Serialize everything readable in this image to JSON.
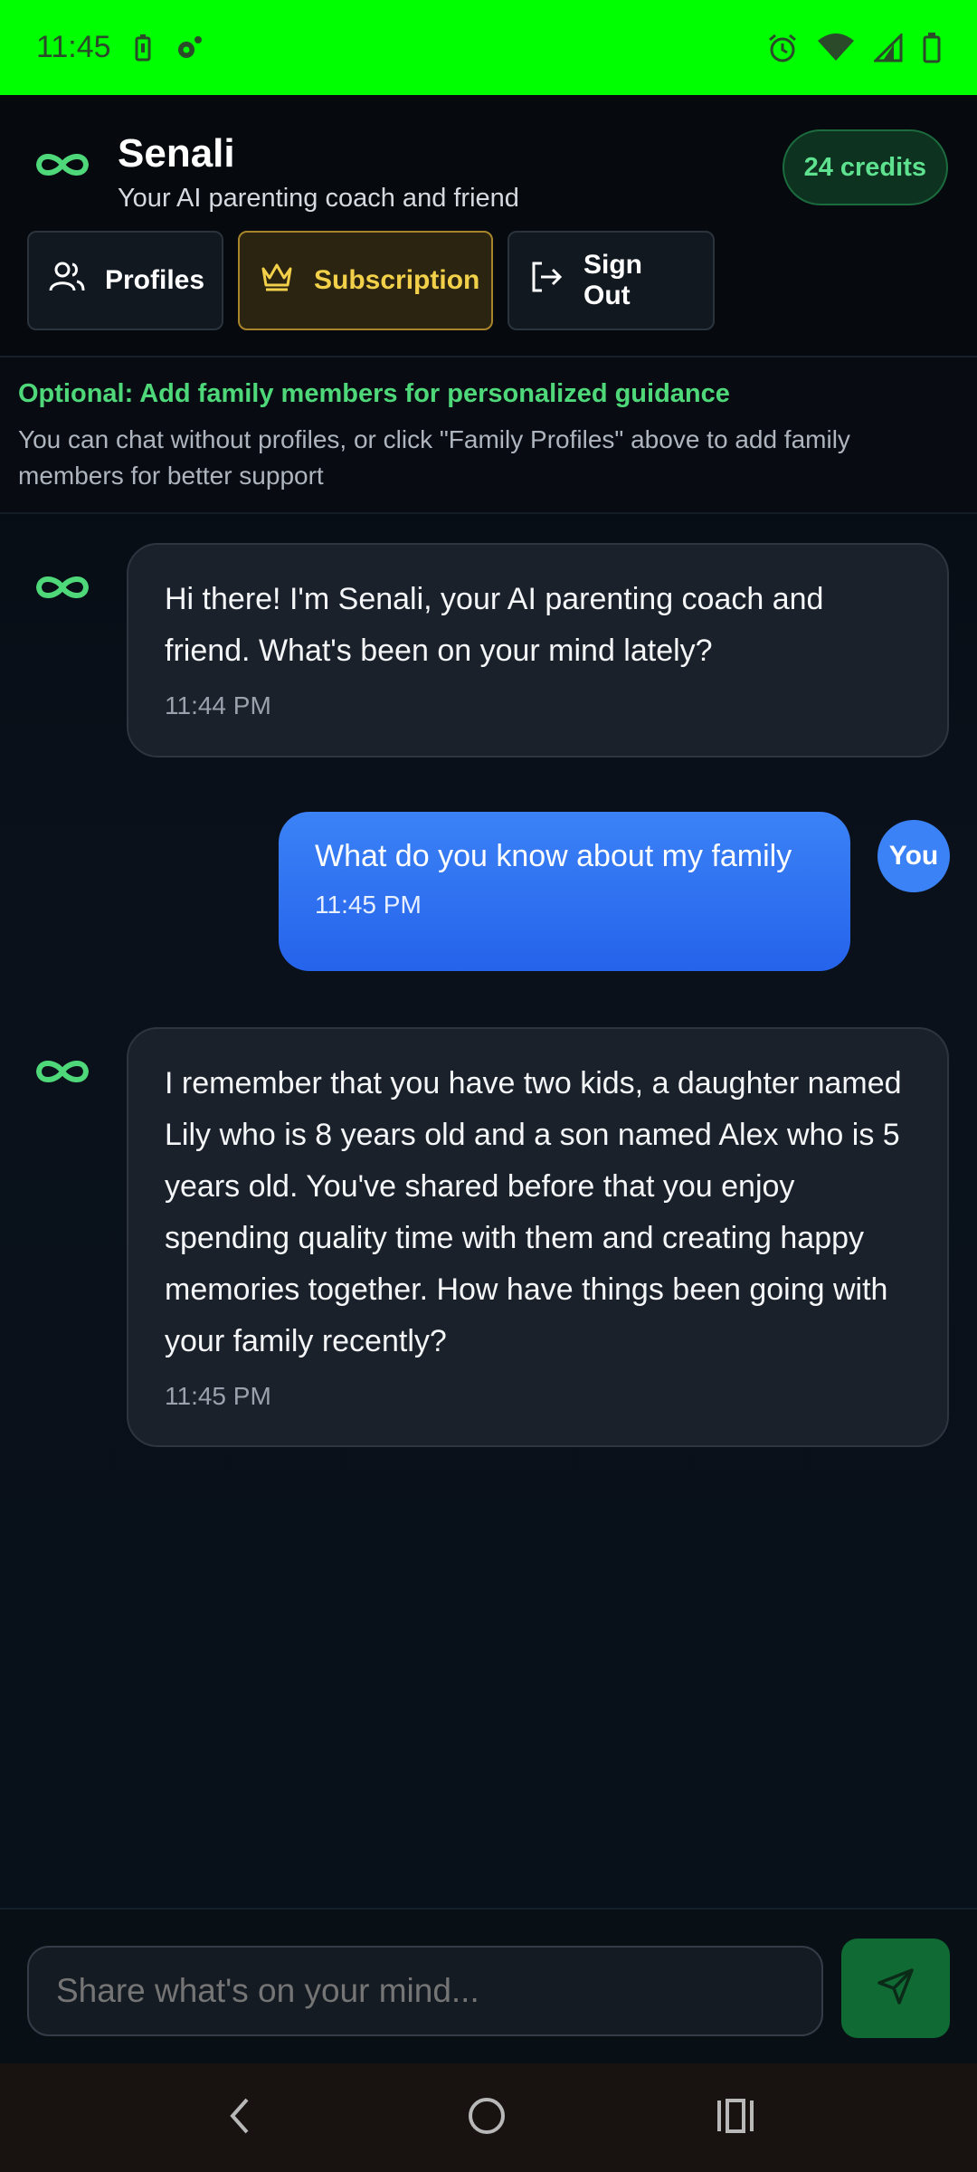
{
  "status_bar": {
    "time": "11:45",
    "icons": [
      "battery-saver-icon",
      "settings-dot-icon",
      "alarm-icon",
      "wifi-icon",
      "signal-icon",
      "battery-icon"
    ]
  },
  "header": {
    "logo_icon": "infinity-icon",
    "title": "Senali",
    "subtitle": "Your AI parenting coach and friend",
    "credits": "24 credits",
    "buttons": {
      "profiles": "Profiles",
      "subscription": "Subscription",
      "sign_out": "Sign Out"
    }
  },
  "info": {
    "title": "Optional: Add family members for personalized guidance",
    "text": "You can chat without profiles, or click \"Family Profiles\" above to add family members for better support"
  },
  "messages": [
    {
      "sender": "ai",
      "text": "Hi there! I'm Senali, your AI parenting coach and friend. What's been on your mind lately?",
      "time": "11:44 PM"
    },
    {
      "sender": "user",
      "avatar": "You",
      "text": "What do you know about my family",
      "time": "11:45 PM"
    },
    {
      "sender": "ai",
      "text": "I remember that you have two kids, a daughter named Lily who is 8 years old and a son named Alex who is 5 years old. You've shared before that you enjoy spending quality time with them and creating happy memories together. How have things been going with your family recently?",
      "time": "11:45 PM"
    }
  ],
  "composer": {
    "placeholder": "Share what's on your mind..."
  },
  "colors": {
    "accent_green": "#4ed879",
    "user_bubble": "#2f6ff0",
    "subscription_gold": "#f2d04a"
  }
}
